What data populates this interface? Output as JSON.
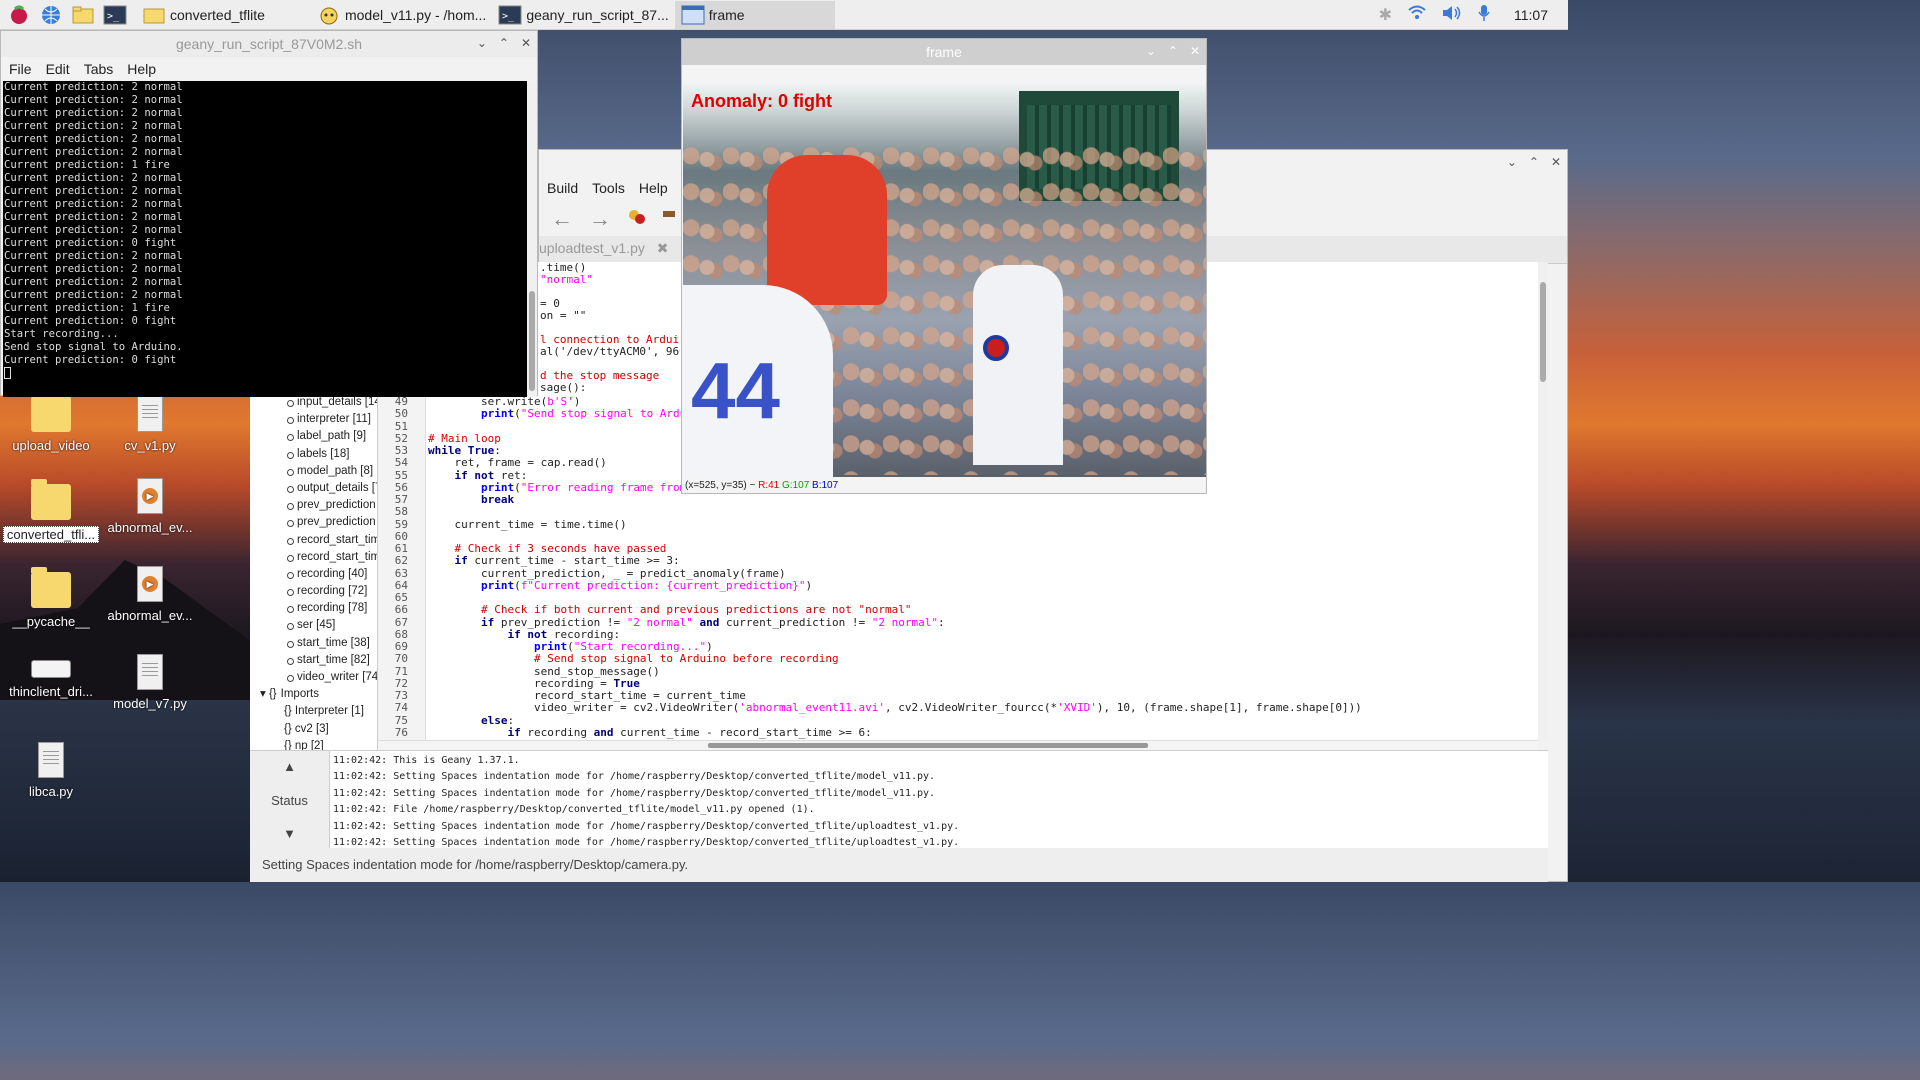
{
  "taskbar": {
    "tasks": [
      {
        "label": "converted_tflite"
      },
      {
        "label": "model_v11.py - /hom..."
      },
      {
        "label": "geany_run_script_87..."
      },
      {
        "label": "frame"
      }
    ],
    "clock": "11:07"
  },
  "desktop": {
    "icons": [
      {
        "label": "upload_video"
      },
      {
        "label": "cv_v1.py"
      },
      {
        "label": "converted_tfli..."
      },
      {
        "label": "abnormal_ev..."
      },
      {
        "label": "__pycache__"
      },
      {
        "label": "abnormal_ev..."
      },
      {
        "label": "thinclient_dri..."
      },
      {
        "label": "model_v7.py"
      },
      {
        "label": "libca.py"
      }
    ]
  },
  "terminal": {
    "title": "geany_run_script_87V0M2.sh",
    "menu": [
      "File",
      "Edit",
      "Tabs",
      "Help"
    ],
    "lines": [
      "Current prediction: 2 normal",
      "Current prediction: 2 normal",
      "Current prediction: 2 normal",
      "Current prediction: 2 normal",
      "Current prediction: 2 normal",
      "Current prediction: 2 normal",
      "Current prediction: 1 fire",
      "Current prediction: 2 normal",
      "Current prediction: 2 normal",
      "Current prediction: 2 normal",
      "Current prediction: 2 normal",
      "Current prediction: 2 normal",
      "Current prediction: 0 fight",
      "Current prediction: 2 normal",
      "Current prediction: 2 normal",
      "Current prediction: 2 normal",
      "Current prediction: 2 normal",
      "Current prediction: 1 fire",
      "Current prediction: 0 fight",
      "Start recording...",
      "Send stop signal to Arduino.",
      "Current prediction: 0 fight"
    ]
  },
  "geany": {
    "menu": [
      "Build",
      "Tools",
      "Help"
    ],
    "tab_label": "uploadtest_v1.py",
    "symbols": [
      {
        "label": "input_details [14"
      },
      {
        "label": "interpreter [11]"
      },
      {
        "label": "label_path [9]"
      },
      {
        "label": "labels [18]"
      },
      {
        "label": "model_path [8]"
      },
      {
        "label": "output_details [7"
      },
      {
        "label": "prev_prediction"
      },
      {
        "label": "prev_prediction"
      },
      {
        "label": "record_start_tim"
      },
      {
        "label": "record_start_tim"
      },
      {
        "label": "recording [40]"
      },
      {
        "label": "recording [72]"
      },
      {
        "label": "recording [78]"
      },
      {
        "label": "ser [45]"
      },
      {
        "label": "start_time [38]"
      },
      {
        "label": "start_time [82]"
      },
      {
        "label": "video_writer [74"
      }
    ],
    "imports_label": "Imports",
    "imports": [
      "Interpreter [1]",
      "cv2 [3]",
      "np [2]"
    ],
    "code_partial": [
      ".time()",
      "\"normal\"",
      "= 0",
      "on = \"\"",
      "l connection to Arduir",
      "al('/dev/ttyACM0', 960",
      "d the stop message",
      "sage():"
    ],
    "code": [
      {
        "n": "49",
        "t": "        ser.write(b'S')"
      },
      {
        "n": "50",
        "t": "        print(\"Send stop signal to Arduino.\")"
      },
      {
        "n": "51",
        "t": ""
      },
      {
        "n": "52",
        "t": "# Main loop"
      },
      {
        "n": "53",
        "t": "while True:"
      },
      {
        "n": "54",
        "t": "    ret, frame = cap.read()"
      },
      {
        "n": "55",
        "t": "    if not ret:"
      },
      {
        "n": "56",
        "t": "        print(\"Error reading frame from camera\")"
      },
      {
        "n": "57",
        "t": "        break"
      },
      {
        "n": "58",
        "t": ""
      },
      {
        "n": "59",
        "t": "    current_time = time.time()"
      },
      {
        "n": "60",
        "t": ""
      },
      {
        "n": "61",
        "t": "    # Check if 3 seconds have passed"
      },
      {
        "n": "62",
        "t": "    if current_time - start_time >= 3:"
      },
      {
        "n": "63",
        "t": "        current_prediction, _ = predict_anomaly(frame)"
      },
      {
        "n": "64",
        "t": "        print(f\"Current prediction: {current_prediction}\")"
      },
      {
        "n": "65",
        "t": ""
      },
      {
        "n": "66",
        "t": "        # Check if both current and previous predictions are not \"normal\""
      },
      {
        "n": "67",
        "t": "        if prev_prediction != \"2 normal\" and current_prediction != \"2 normal\":"
      },
      {
        "n": "68",
        "t": "            if not recording:"
      },
      {
        "n": "69",
        "t": "                print(\"Start recording...\")"
      },
      {
        "n": "70",
        "t": "                # Send stop signal to Arduino before recording"
      },
      {
        "n": "71",
        "t": "                send_stop_message()"
      },
      {
        "n": "72",
        "t": "                recording = True"
      },
      {
        "n": "73",
        "t": "                record_start_time = current_time"
      },
      {
        "n": "74",
        "t": "                video_writer = cv2.VideoWriter('abnormal_event11.avi', cv2.VideoWriter_fourcc(*'XVID'), 10, (frame.shape[1], frame.shape[0]))"
      },
      {
        "n": "75",
        "t": "        else:"
      },
      {
        "n": "76",
        "t": "            if recording and current_time - record_start_time >= 6:"
      }
    ],
    "status_tab": "Status",
    "messages": [
      "11:02:42: This is Geany 1.37.1.",
      "11:02:42: Setting Spaces indentation mode for /home/raspberry/Desktop/converted_tflite/model_v11.py.",
      "11:02:42: Setting Spaces indentation mode for /home/raspberry/Desktop/converted_tflite/model_v11.py.",
      "11:02:42: File /home/raspberry/Desktop/converted_tflite/model_v11.py opened (1).",
      "11:02:42: Setting Spaces indentation mode for /home/raspberry/Desktop/converted_tflite/uploadtest_v1.py.",
      "11:02:42: Setting Spaces indentation mode for /home/raspberry/Desktop/converted_tflite/uploadtest_v1.py."
    ],
    "statusbar": "Setting Spaces indentation mode for /home/raspberry/Desktop/camera.py."
  },
  "frame_window": {
    "title": "frame",
    "overlay_label": "Anomaly: 0 fight",
    "jersey_number": "44",
    "status_coords": "(x=525, y=35) ~",
    "status_r": "R:41",
    "status_g": "G:107",
    "status_b": "B:107"
  },
  "colors": {
    "overlay_text": "#e00000",
    "keyword": "#00007f",
    "string": "#ff00ff",
    "comment": "#d00000"
  }
}
